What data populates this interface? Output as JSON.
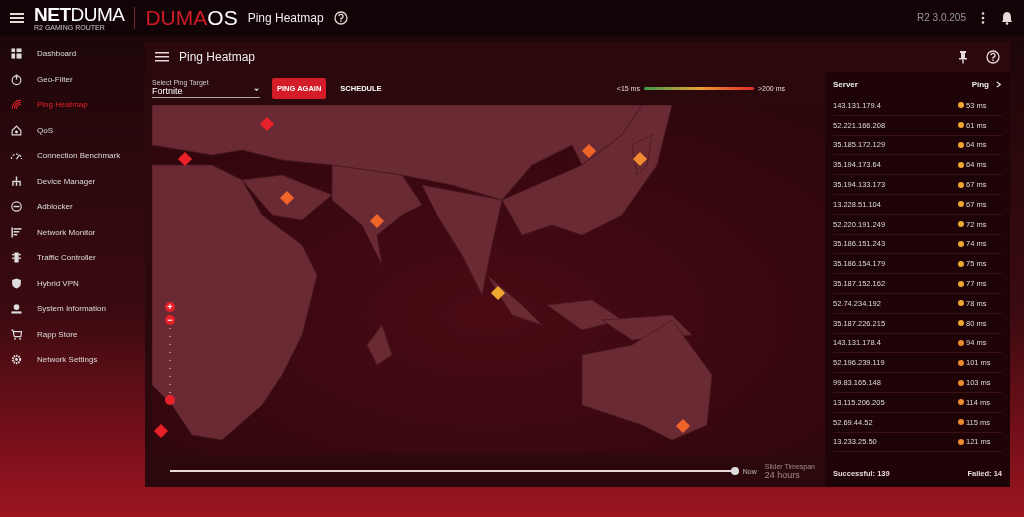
{
  "header": {
    "logo": "**NET**DUMA",
    "logo_subtitle": "R2 GAMING ROUTER",
    "os_logo": "DUMA**OS**",
    "page_title": "Ping Heatmap",
    "version": "R2 3.0.205"
  },
  "sidebar": {
    "items": [
      {
        "label": "Dashboard",
        "selected": false
      },
      {
        "label": "Geo-Filter",
        "selected": false
      },
      {
        "label": "Ping Heatmap",
        "selected": true
      },
      {
        "label": "QoS",
        "selected": false
      },
      {
        "label": "Connection Benchmark",
        "selected": false
      },
      {
        "label": "Device Manager",
        "selected": false
      },
      {
        "label": "Adblocker",
        "selected": false
      },
      {
        "label": "Network Monitor",
        "selected": false
      },
      {
        "label": "Traffic Controller",
        "selected": false
      },
      {
        "label": "Hybrid VPN",
        "selected": false
      },
      {
        "label": "System Information",
        "selected": false
      },
      {
        "label": "Rapp Store",
        "selected": false
      },
      {
        "label": "Network Settings",
        "selected": false
      }
    ]
  },
  "panel": {
    "title": "Ping Heatmap",
    "target": {
      "label": "Select Ping Target",
      "value": "Fortnite"
    },
    "buttons": [
      "PING AGAIN",
      "SCHEDULE"
    ],
    "legend": {
      "low": "<15 ms",
      "high": ">200 ms"
    },
    "map": {
      "markers": [
        {
          "color": "#e8202a"
        },
        {
          "color": "#e8202a"
        },
        {
          "color": "#f0642a"
        },
        {
          "color": "#f0642a"
        },
        {
          "color": "#f0642a"
        },
        {
          "color": "#f08a30"
        },
        {
          "color": "#f0a830"
        },
        {
          "color": "#e8202a"
        },
        {
          "color": "#f0642a"
        }
      ],
      "zoom": {
        "plus": "+",
        "minus": "−",
        "level": 0.1
      }
    },
    "timeline": {
      "level": 1,
      "now": "Now",
      "timespan_label": "Slider Timespan",
      "timespan_value": "24 hours"
    },
    "servers": {
      "columns": [
        "Server",
        "Ping"
      ],
      "rows": [
        {
          "server": "143.131.179.4",
          "ping": "53 ms",
          "color": "#f0a830"
        },
        {
          "server": "52.221.166.208",
          "ping": "61 ms",
          "color": "#f0a830"
        },
        {
          "server": "35.185.172.129",
          "ping": "64 ms",
          "color": "#f0a830"
        },
        {
          "server": "35.194.173.64",
          "ping": "64 ms",
          "color": "#f0a830"
        },
        {
          "server": "35.194.133.173",
          "ping": "67 ms",
          "color": "#f0a830"
        },
        {
          "server": "13.228.51.104",
          "ping": "67 ms",
          "color": "#f0a830"
        },
        {
          "server": "52.220.191.249",
          "ping": "72 ms",
          "color": "#f0a830"
        },
        {
          "server": "35.186.151.243",
          "ping": "74 ms",
          "color": "#f0a830"
        },
        {
          "server": "35.186.154.179",
          "ping": "75 ms",
          "color": "#f0a830"
        },
        {
          "server": "35.187.152.162",
          "ping": "77 ms",
          "color": "#f0a830"
        },
        {
          "server": "52.74.234.192",
          "ping": "78 ms",
          "color": "#f0a830"
        },
        {
          "server": "35.187.226.215",
          "ping": "80 ms",
          "color": "#f0a830"
        },
        {
          "server": "143.131.178.4",
          "ping": "94 ms",
          "color": "#f08a30"
        },
        {
          "server": "52.196.239.119",
          "ping": "101 ms",
          "color": "#f08a30"
        },
        {
          "server": "99.83.165.148",
          "ping": "103 ms",
          "color": "#f08a30"
        },
        {
          "server": "13.115.206.205",
          "ping": "114 ms",
          "color": "#f08a30"
        },
        {
          "server": "52.69.44.52",
          "ping": "115 ms",
          "color": "#f08a30"
        },
        {
          "server": "13.233.25.50",
          "ping": "121 ms",
          "color": "#f08a30"
        }
      ],
      "successful": "Successful: 139",
      "failed": "Failed: 14"
    }
  }
}
